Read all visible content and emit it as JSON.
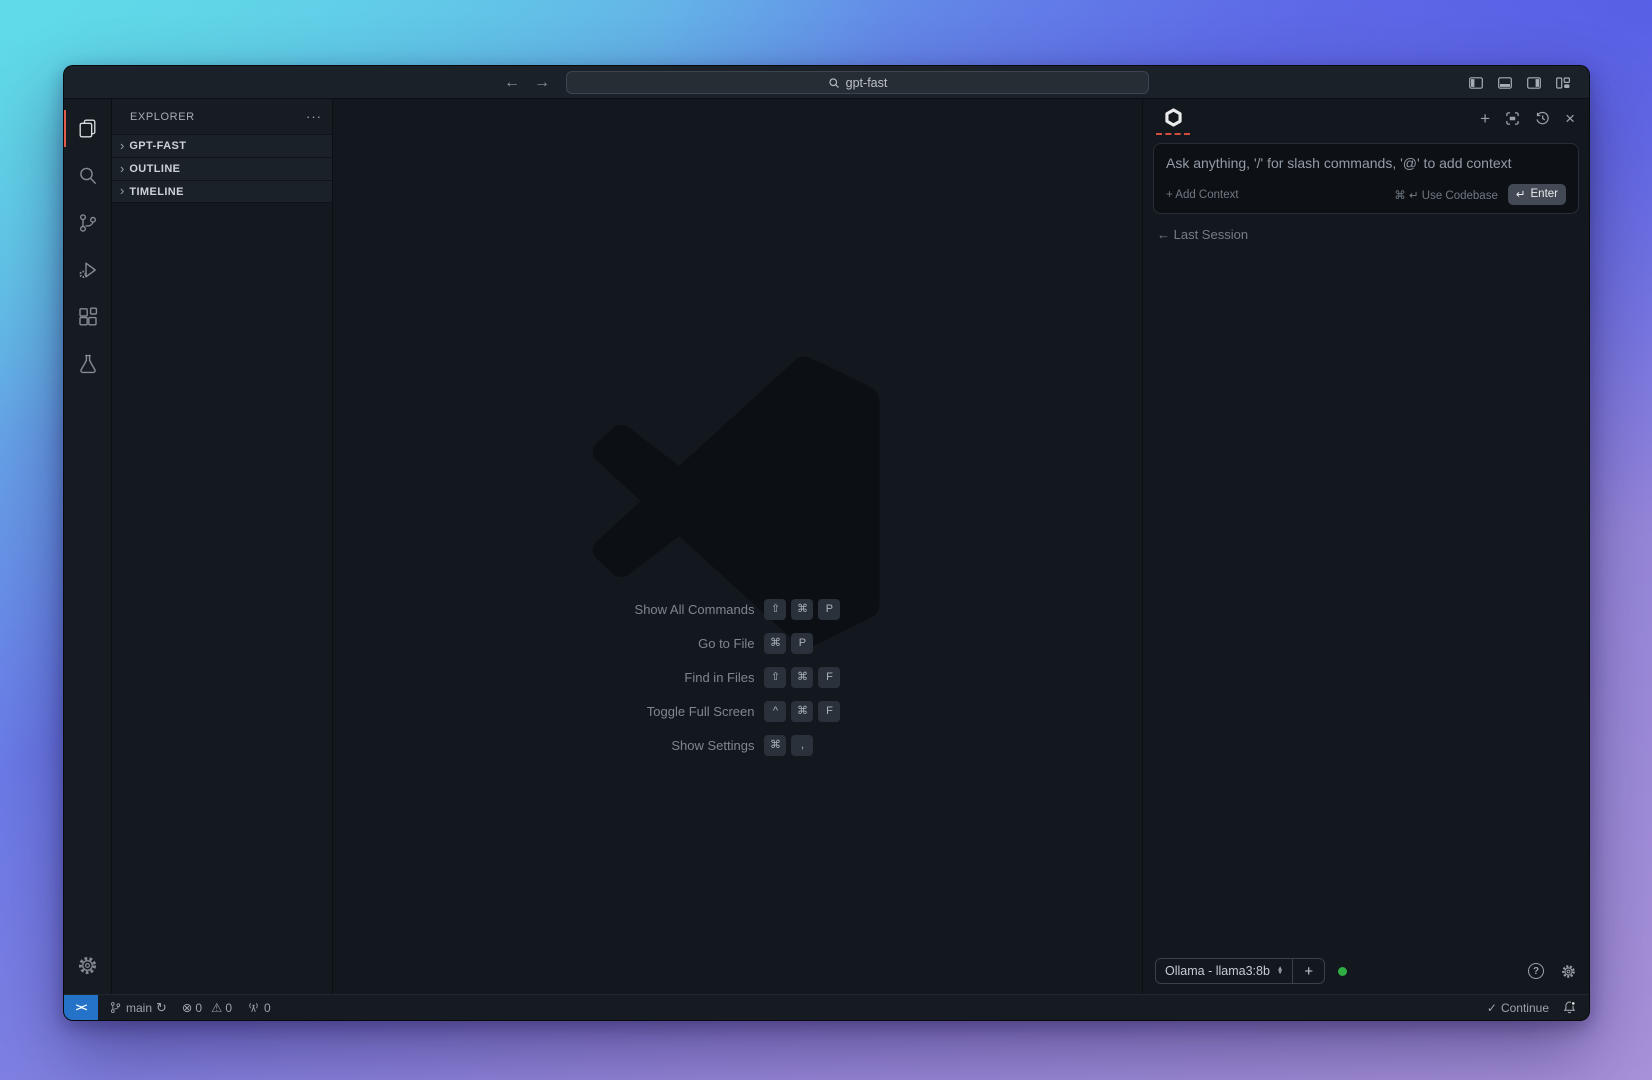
{
  "titlebar": {
    "back": "←",
    "forward": "→",
    "search_value": "gpt-fast"
  },
  "explorer": {
    "header": "EXPLORER",
    "overflow_menu": "···",
    "sections": [
      "GPT-FAST",
      "OUTLINE",
      "TIMELINE"
    ]
  },
  "editor_watermark": {
    "shortcuts": [
      {
        "label": "Show All Commands",
        "keys": [
          "⇧",
          "⌘",
          "P"
        ]
      },
      {
        "label": "Go to File",
        "keys": [
          "⌘",
          "P"
        ]
      },
      {
        "label": "Find in Files",
        "keys": [
          "⇧",
          "⌘",
          "F"
        ]
      },
      {
        "label": "Toggle Full Screen",
        "keys": [
          "^",
          "⌘",
          "F"
        ]
      },
      {
        "label": "Show Settings",
        "keys": [
          "⌘",
          ","
        ]
      }
    ]
  },
  "assistant_panel": {
    "input_placeholder": "Ask anything, '/' for slash commands, '@' to add context",
    "add_context": "+ Add Context",
    "use_codebase": "⌘ ↵ Use Codebase",
    "enter_key": "↵",
    "enter_label": "Enter",
    "last_session": "← Last Session",
    "model": "Ollama - llama3:8b",
    "add_model": "+",
    "new_session": "+",
    "close": "×",
    "help": "?",
    "accent_underline": "#cf4f3e",
    "status_dot_color": "#2fae43"
  },
  "status_bar": {
    "remote": "><",
    "branch": "main",
    "sync": "↻",
    "errors": "0",
    "warnings": "0",
    "error_glyph": "⊗",
    "warning_glyph": "⚠",
    "ports": "0",
    "check": "✓",
    "continue_label": "Continue"
  }
}
